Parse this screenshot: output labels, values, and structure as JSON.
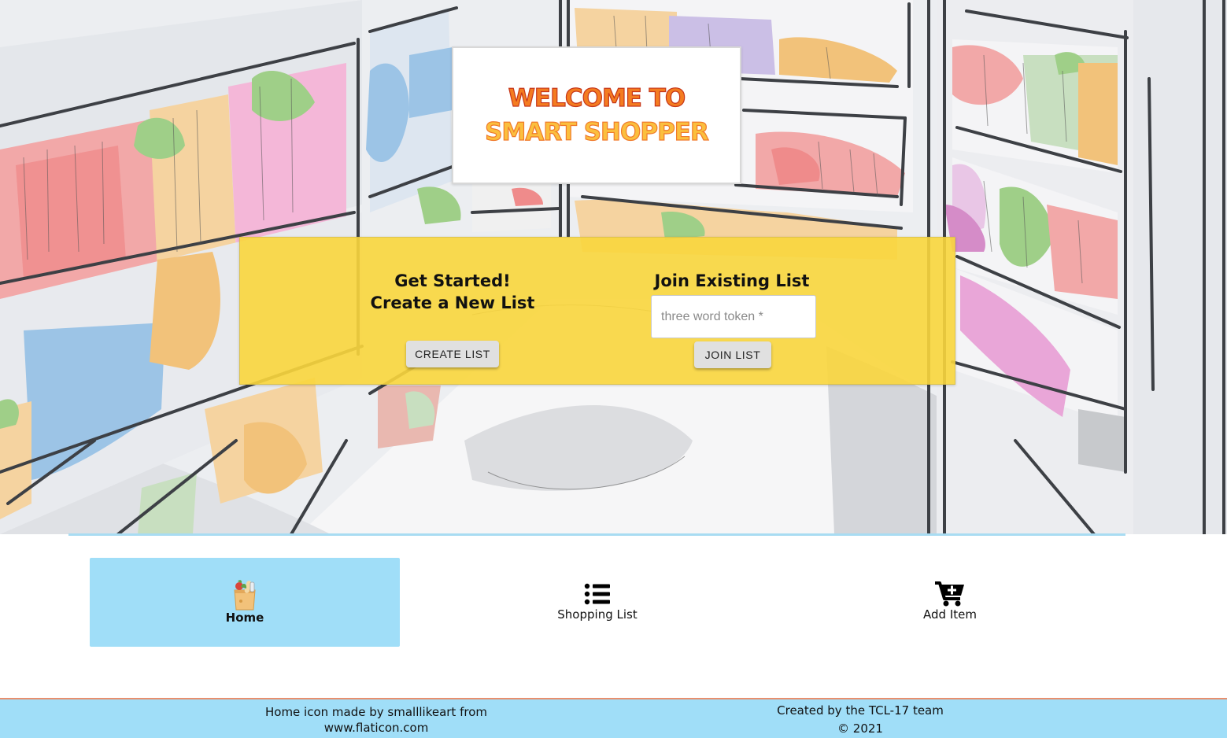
{
  "welcome": {
    "line1": "WELCOME TO",
    "line2": "SMART SHOPPER"
  },
  "create": {
    "heading_line1": "Get Started!",
    "heading_line2": "Create a New List",
    "button_label": "CREATE LIST"
  },
  "join": {
    "heading": "Join Existing List",
    "input_placeholder": "three word token *",
    "input_value": "",
    "button_label": "JOIN LIST"
  },
  "nav": {
    "items": [
      {
        "label": "Home",
        "icon": "grocery-bag-icon",
        "active": true
      },
      {
        "label": "Shopping List",
        "icon": "list-icon",
        "active": false
      },
      {
        "label": "Add Item",
        "icon": "cart-plus-icon",
        "active": false
      }
    ]
  },
  "footer": {
    "left_line1": "Home icon made by smalllikeart from",
    "left_line2": "www.flaticon.com",
    "right_line1": "Created by the TCL-17 team",
    "right_line2": "© 2021"
  },
  "colors": {
    "panel_yellow": "#fad63c",
    "nav_active": "#a0def8",
    "footer_bg": "#a0def8",
    "footer_border": "#e88f6e",
    "divider": "#a8dcf2",
    "welcome_orange": "#f47c20",
    "welcome_yellow": "#fbbf3e"
  }
}
